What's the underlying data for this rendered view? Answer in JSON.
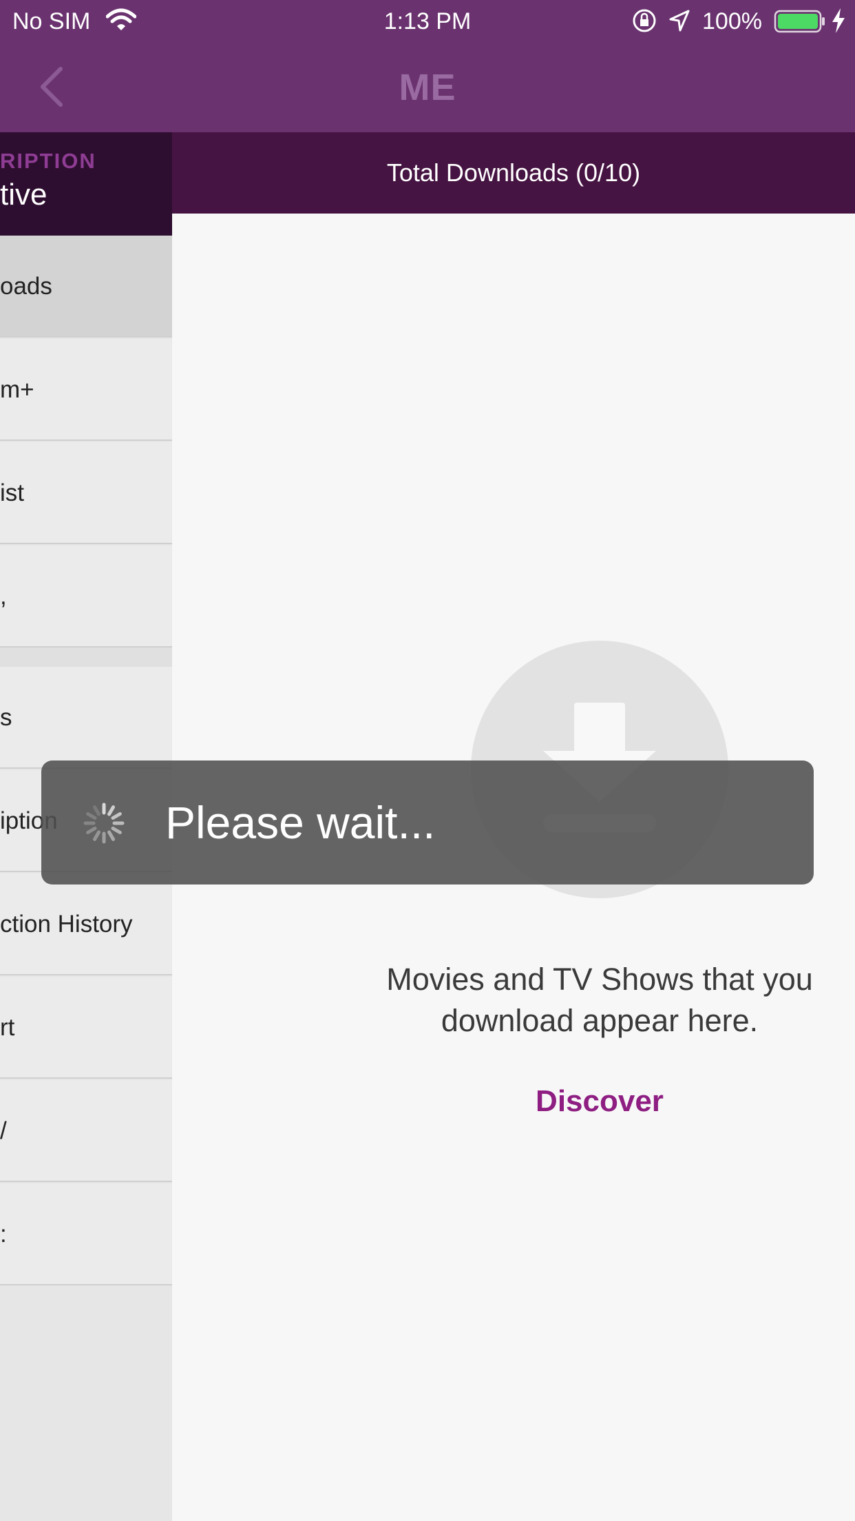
{
  "status_bar": {
    "carrier": "No SIM",
    "time": "1:13 PM",
    "battery_percent": "100%",
    "icons": [
      "wifi-icon",
      "orientation-lock-icon",
      "location-icon",
      "battery-icon",
      "charging-icon"
    ]
  },
  "nav": {
    "title": "ME",
    "back_icon": "chevron-left-icon"
  },
  "sidebar": {
    "subscription_label": "RIPTION",
    "subscription_status": "tive",
    "items": [
      {
        "label": "oads",
        "active": true
      },
      {
        "label": "m+"
      },
      {
        "label": "ist"
      },
      {
        "label": ","
      },
      {
        "label": "s"
      },
      {
        "label": "iption"
      },
      {
        "label": "ction History"
      },
      {
        "label": "rt"
      },
      {
        "label": "/"
      },
      {
        "label": ":"
      }
    ]
  },
  "main": {
    "header_title": "Total Downloads (0/10)",
    "empty_icon": "download-icon",
    "empty_message": "Movies and TV Shows that you download appear here.",
    "discover_label": "Discover"
  },
  "overlay": {
    "loading_text": "Please wait...",
    "spinner_icon": "spinner-icon"
  },
  "colors": {
    "nav_bg": "#6a336f",
    "sidebar_header_bg": "#2e0e30",
    "downloads_header_bg": "#461442",
    "accent": "#8e1e82",
    "battery": "#4cd964"
  }
}
